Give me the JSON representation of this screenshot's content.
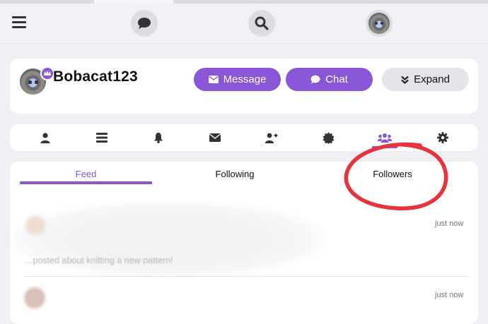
{
  "topbar": {
    "menu_icon": "hamburger-menu-icon",
    "chat_icon": "chat-bubble-icon",
    "search_icon": "search-icon",
    "avatar": "user-avatar"
  },
  "profile": {
    "username": "Bobacat123",
    "badge_icon": "crown-icon",
    "message_label": "Message",
    "message_icon": "envelope-icon",
    "chat_label": "Chat",
    "chat_icon": "chat-bubble-icon",
    "expand_label": "Expand",
    "expand_icon": "double-chevron-down-icon"
  },
  "icon_tabs": [
    {
      "icon": "person-icon",
      "active": false
    },
    {
      "icon": "list-icon",
      "active": false
    },
    {
      "icon": "bell-icon",
      "active": false
    },
    {
      "icon": "envelope-icon",
      "active": false
    },
    {
      "icon": "add-user-icon",
      "active": false
    },
    {
      "icon": "badge-icon",
      "active": false
    },
    {
      "icon": "group-icon",
      "active": true
    },
    {
      "icon": "gear-icon",
      "active": false
    }
  ],
  "feed": {
    "tabs": [
      {
        "label": "Feed",
        "active": true
      },
      {
        "label": "Following",
        "active": false
      },
      {
        "label": "Followers",
        "active": false
      }
    ],
    "posts": [
      {
        "time": "just now",
        "text": "…posted about knitting a new pattern!"
      },
      {
        "time": "just now"
      }
    ]
  },
  "colors": {
    "accent": "#8a55d6",
    "annotation": "#e8323c"
  }
}
